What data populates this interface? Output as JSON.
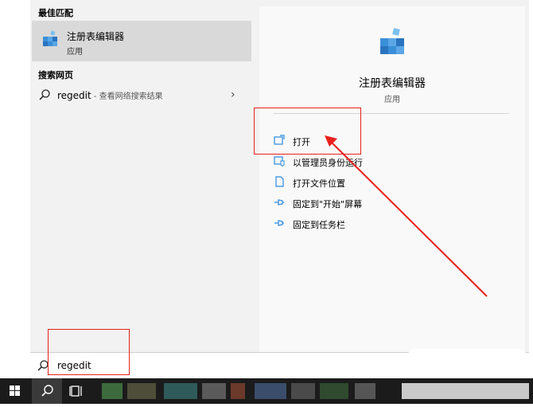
{
  "left_panel": {
    "best_match_title": "最佳匹配",
    "best_match": {
      "name": "注册表编辑器",
      "type": "应用"
    },
    "web_search_title": "搜索网页",
    "web_result": {
      "query": "regedit",
      "hint": " - 查看网络搜索结果"
    }
  },
  "right_panel": {
    "app_name": "注册表编辑器",
    "app_type": "应用",
    "actions": [
      {
        "label": "打开",
        "icon": "open-icon"
      },
      {
        "label": "以管理员身份运行",
        "icon": "shield-admin-icon"
      },
      {
        "label": "打开文件位置",
        "icon": "file-location-icon"
      },
      {
        "label": "固定到\"开始\"屏幕",
        "icon": "pin-icon"
      },
      {
        "label": "固定到任务栏",
        "icon": "pin-icon"
      }
    ]
  },
  "search_box": {
    "value": "regedit",
    "icon": "search-icon"
  },
  "taskbar": {
    "icons": [
      "windows-start-icon",
      "search-icon",
      "task-view-icon"
    ]
  },
  "colors": {
    "annotation_red": "#e8211c",
    "accent_blue": "#2a8ae0",
    "taskbar": "#1b1b1b"
  }
}
